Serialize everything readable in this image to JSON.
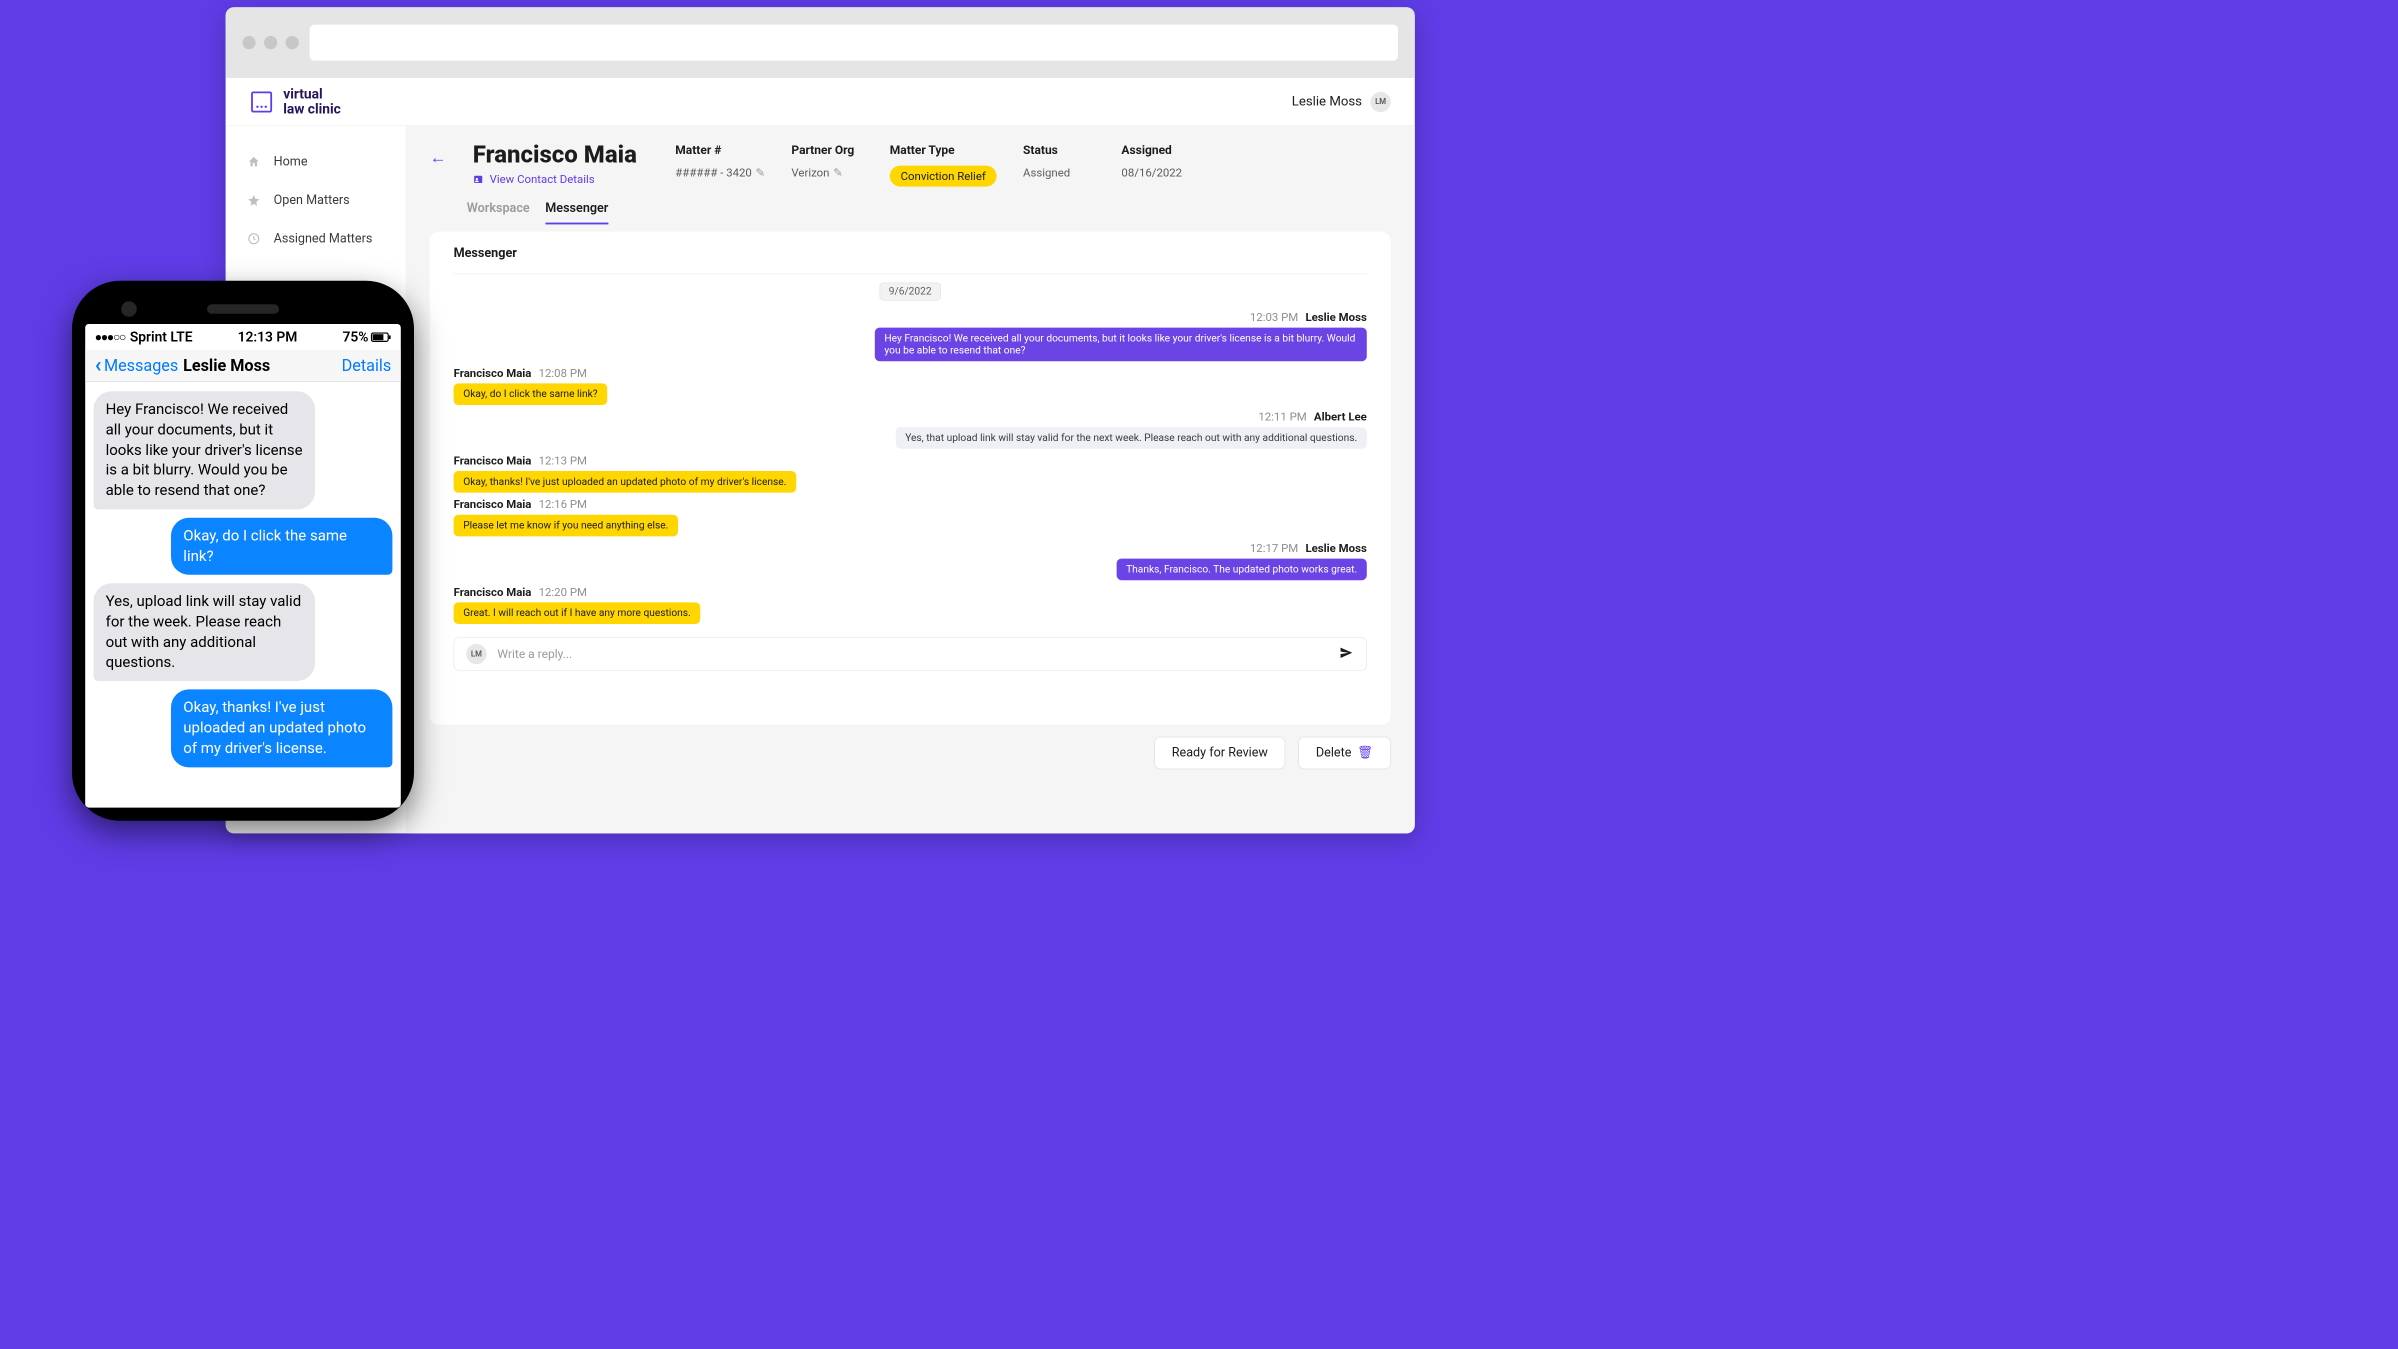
{
  "branding": {
    "name1": "virtual",
    "name2": "law clinic"
  },
  "user": {
    "name": "Leslie Moss",
    "initials": "LM"
  },
  "sidebar": {
    "items": [
      {
        "label": "Home"
      },
      {
        "label": "Open Matters"
      },
      {
        "label": "Assigned Matters"
      }
    ]
  },
  "case": {
    "title": "Francisco Maia",
    "contact_link": "View Contact Details",
    "tabs": {
      "workspace": "Workspace",
      "messenger": "Messenger"
    },
    "meta": {
      "matter_no": {
        "label": "Matter #",
        "value": "###### - 3420"
      },
      "partner": {
        "label": "Partner Org",
        "value": "Verizon"
      },
      "type": {
        "label": "Matter Type",
        "value": "Conviction Relief"
      },
      "status": {
        "label": "Status",
        "value": "Assigned"
      },
      "assigned": {
        "label": "Assigned",
        "value": "08/16/2022"
      }
    }
  },
  "messenger": {
    "title": "Messenger",
    "date": "9/6/2022",
    "reply_placeholder": "Write a reply...",
    "messages": [
      {
        "side": "right",
        "name": "Leslie Moss",
        "time": "12:03 PM",
        "text": "Hey Francisco! We received all your documents, but it looks like your driver's license is a bit blurry. Would you be able to resend that one?",
        "style": "purple"
      },
      {
        "side": "left",
        "name": "Francisco Maia",
        "time": "12:08 PM",
        "text": "Okay, do I click the same link?",
        "style": "yellow"
      },
      {
        "side": "right",
        "name": "Albert Lee",
        "time": "12:11 PM",
        "text": "Yes, that upload link will stay valid for the next week. Please reach out with any additional questions.",
        "style": "gray"
      },
      {
        "side": "left",
        "name": "Francisco Maia",
        "time": "12:13 PM",
        "text": "Okay, thanks! I've just uploaded an updated photo of my driver's license.",
        "style": "yellow"
      },
      {
        "side": "left",
        "name": "Francisco Maia",
        "time": "12:16 PM",
        "text": "Please let me know if you need anything else.",
        "style": "yellow"
      },
      {
        "side": "right",
        "name": "Leslie Moss",
        "time": "12:17 PM",
        "text": "Thanks, Francisco. The updated photo works great.",
        "style": "purple"
      },
      {
        "side": "left",
        "name": "Francisco Maia",
        "time": "12:20 PM",
        "text": "Great. I will reach out if I have any more questions.",
        "style": "yellow"
      }
    ]
  },
  "actions": {
    "review": "Ready for Review",
    "delete": "Delete"
  },
  "phone": {
    "carrier": "Sprint  LTE",
    "time": "12:13 PM",
    "battery": "75%",
    "back": "Messages",
    "chat_name": "Leslie Moss",
    "details": "Details",
    "thread": [
      {
        "dir": "in",
        "text": "Hey Francisco! We received all your documents, but it looks like your driver's license is a bit blurry. Would you be able to resend that one?"
      },
      {
        "dir": "out",
        "text": "Okay, do I click the same link?"
      },
      {
        "dir": "in",
        "text": "Yes, upload link will stay valid for the week. Please reach out with any additional questions."
      },
      {
        "dir": "out",
        "text": "Okay, thanks! I've just uploaded an updated photo of my driver's license."
      }
    ]
  }
}
